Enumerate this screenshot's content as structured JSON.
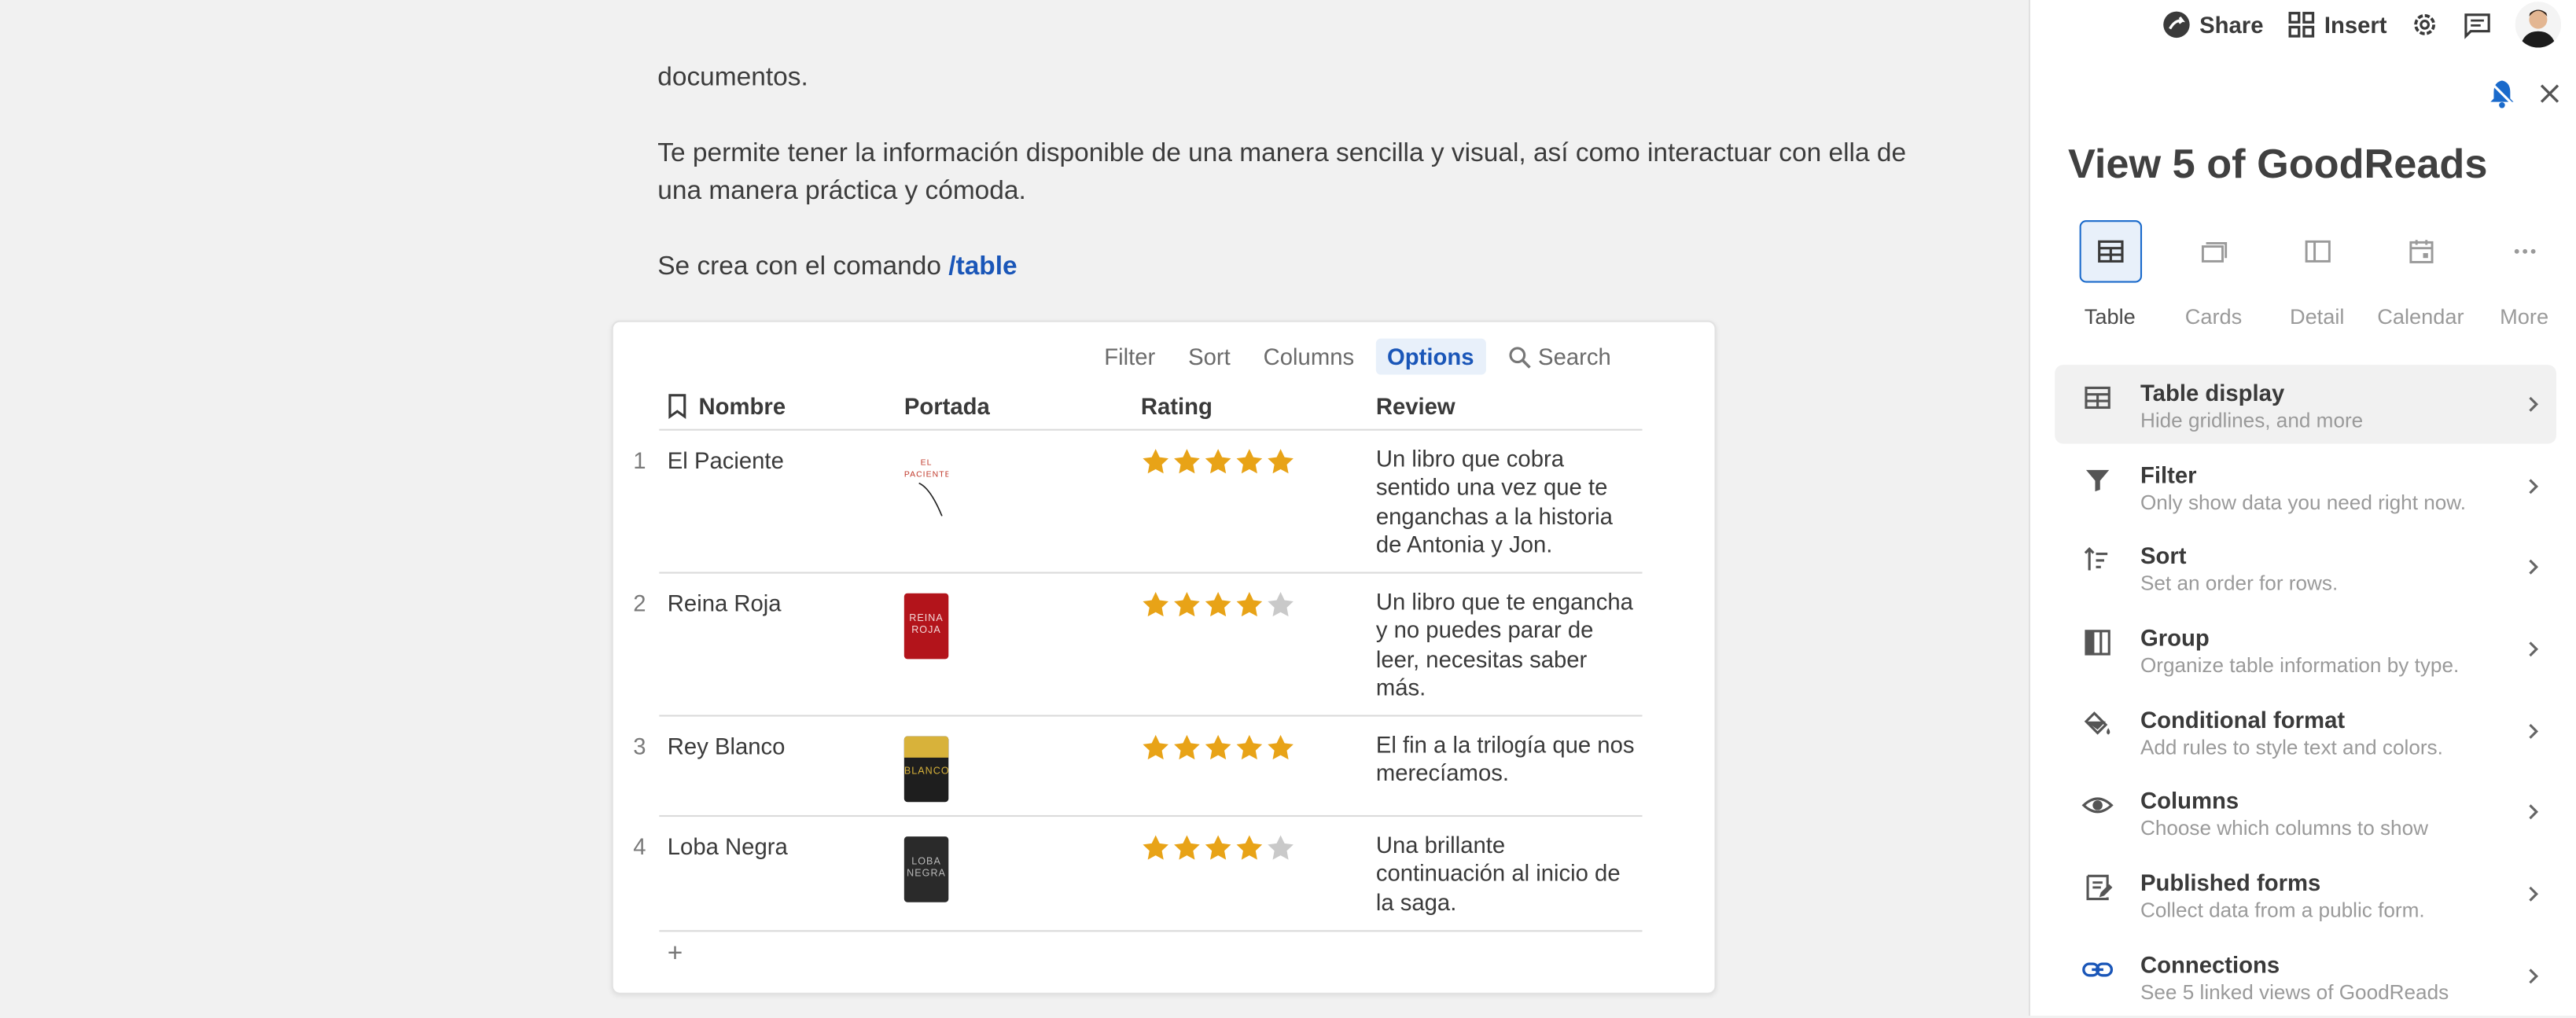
{
  "document": {
    "para1": "documentos.",
    "para2": "Te permite tener la información disponible de una manera sencilla y visual, así como interactuar con ella de una manera práctica y cómoda.",
    "para3_prefix": "Se crea con el comando ",
    "para3_command": "/table"
  },
  "table": {
    "toolbar": {
      "filter": "Filter",
      "sort": "Sort",
      "columns": "Columns",
      "options": "Options",
      "search": "Search"
    },
    "headers": {
      "name": "Nombre",
      "cover": "Portada",
      "rating": "Rating",
      "review": "Review"
    },
    "rows": [
      {
        "num": "1",
        "name": "El Paciente",
        "rating": 5,
        "review": "Un libro que cobra sentido una vez que te enganchas a la historia de Antonia y Jon.",
        "cover_text": "EL PACIENTE"
      },
      {
        "num": "2",
        "name": "Reina Roja",
        "rating": 4,
        "review": "Un libro que te engancha y no puedes parar de leer, necesitas saber más.",
        "cover_text": "REINA ROJA"
      },
      {
        "num": "3",
        "name": "Rey Blanco",
        "rating": 5,
        "review": "El fin a la trilogía que nos merecíamos.",
        "cover_text": "BLANCO"
      },
      {
        "num": "4",
        "name": "Loba Negra",
        "rating": 4,
        "review": "Una brillante continuación al inicio de la saga.",
        "cover_text": "LOBA NEGRA"
      }
    ],
    "add_row": "+"
  },
  "topbar": {
    "share": "Share",
    "insert": "Insert"
  },
  "panel": {
    "title": "View 5 of GoodReads",
    "views": [
      {
        "label": "Table",
        "icon": "table-icon"
      },
      {
        "label": "Cards",
        "icon": "cards-icon"
      },
      {
        "label": "Detail",
        "icon": "detail-icon"
      },
      {
        "label": "Calendar",
        "icon": "calendar-icon"
      },
      {
        "label": "More",
        "icon": "more-icon"
      }
    ],
    "menu": [
      {
        "title": "Table display",
        "sub": "Hide gridlines, and more",
        "icon": "table-icon"
      },
      {
        "title": "Filter",
        "sub": "Only show data you need right now.",
        "icon": "filter-icon"
      },
      {
        "title": "Sort",
        "sub": "Set an order for rows.",
        "icon": "sort-icon"
      },
      {
        "title": "Group",
        "sub": "Organize table information by type.",
        "icon": "group-icon"
      },
      {
        "title": "Conditional format",
        "sub": "Add rules to style text and colors.",
        "icon": "paint-bucket-icon"
      },
      {
        "title": "Columns",
        "sub": "Choose which columns to show",
        "icon": "eye-icon"
      },
      {
        "title": "Published forms",
        "sub": "Collect data from a public form.",
        "icon": "form-icon"
      },
      {
        "title": "Connections",
        "sub": "See 5 linked views of GoodReads",
        "icon": "link-icon"
      }
    ]
  },
  "colors": {
    "accent": "#1a56b8",
    "star": "#e8a317",
    "star_empty": "#c9c9c9"
  }
}
